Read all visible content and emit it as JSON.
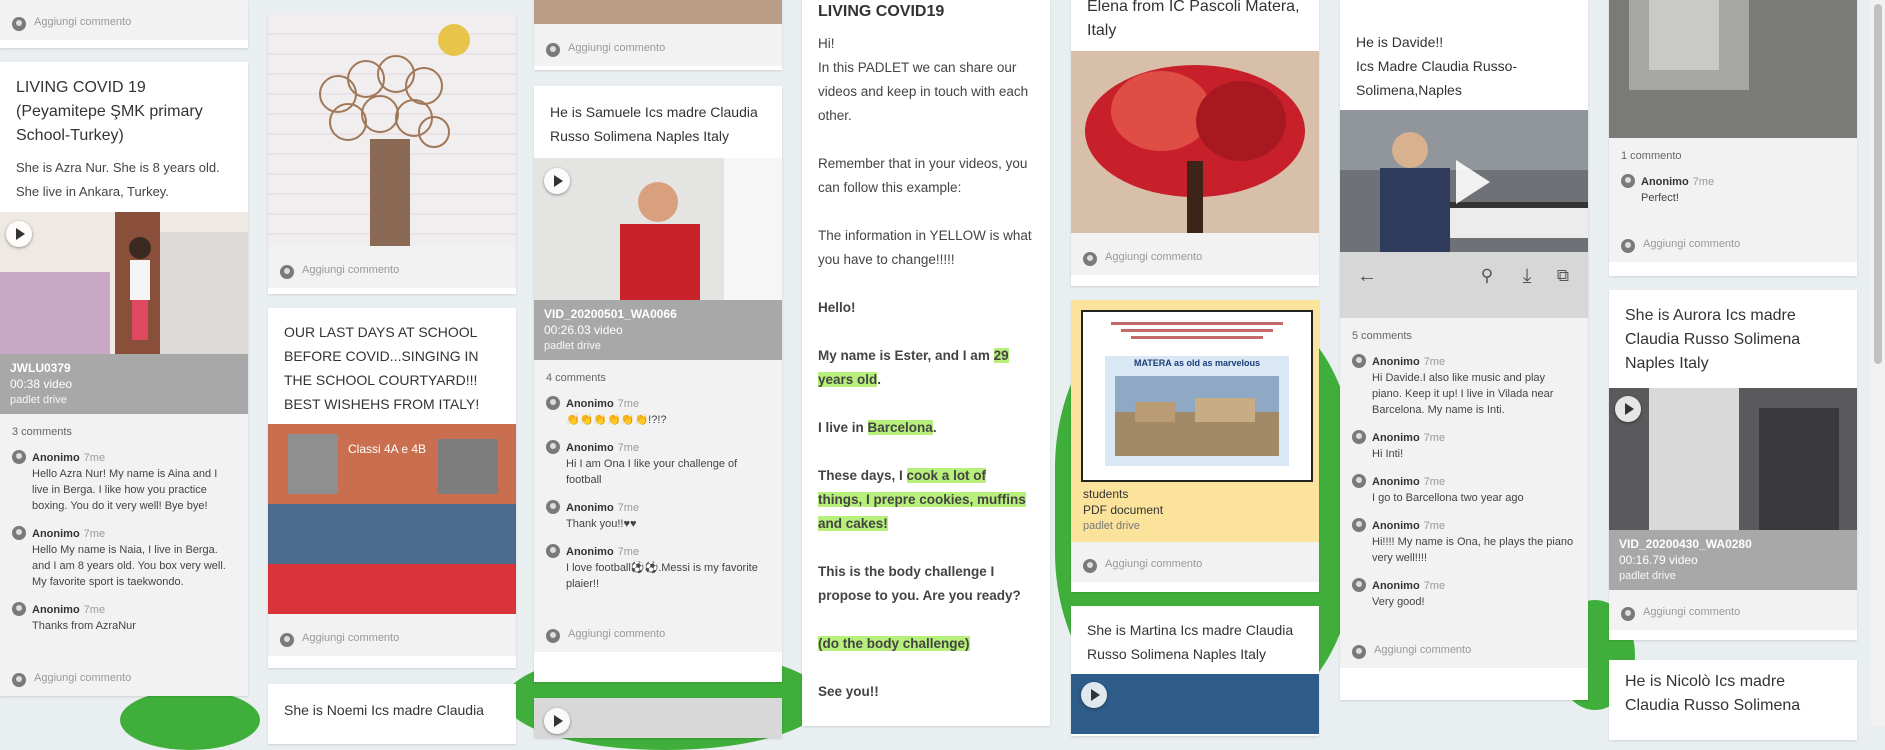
{
  "ui": {
    "add_comment": "Aggiungi commento",
    "author": "Anonimo",
    "time": "7me"
  },
  "col1": {
    "top_add": "Aggiungi commento",
    "title": "LIVING COVID 19 (Peyamitepe ŞMK primary School-Turkey)",
    "body": "She is Azra Nur. She is 8 years old. She live in Ankara, Turkey.",
    "attachment": {
      "name": "JWLU0379",
      "sub": "00:38 video",
      "src": "padlet drive"
    },
    "comment_count": "3 comments",
    "comments": [
      {
        "text": "Hello Azra Nur! My name is Aina and I live in Berga. I like how you practice boxing. You do it very well! Bye bye!"
      },
      {
        "text": "Hello My name is Naia, I live in Berga. and I am 8 years old. You box very well. My favorite sport is taekwondo."
      },
      {
        "text": "Thanks from AzraNur"
      }
    ]
  },
  "col2": {
    "title": "OUR LAST DAYS AT SCHOOL BEFORE COVID...SINGING IN THE SCHOOL COURTYARD!!! BEST WISHEHS FROM ITALY!",
    "photo_caption": "Classi 4A e 4B",
    "next_title": "She is Noemi Ics madre Claudia"
  },
  "col3": {
    "title": "He is Samuele Ics madre Claudia Russo Solimena Naples Italy",
    "attachment": {
      "name": "VID_20200501_WA0066",
      "sub": "00:26.03 video",
      "src": "padlet drive"
    },
    "comment_count": "4 comments",
    "comments": [
      {
        "text": "👏👏👏👏👏👏!?!?"
      },
      {
        "text": "Hi I am Ona I like your challenge of football"
      },
      {
        "text": "Thank you!!♥♥"
      },
      {
        "text": "I love football⚽⚽.Messi is my favorite plaier!!"
      }
    ]
  },
  "col4": {
    "title": "LIVING COVID19",
    "p1": "Hi!",
    "p2": "In this PADLET we can share our videos and keep in touch with each other.",
    "p3": "Remember that in your videos, you can follow this example:",
    "p4": "The information in YELLOW is what you have to change!!!!!",
    "p5": "Hello!",
    "p6a": "My name is Ester, and I am ",
    "p6b": "29 years old",
    "p6c": ".",
    "p7a": "I live in ",
    "p7b": "Barcelona",
    "p7c": ".",
    "p8a": "These days, I ",
    "p8b": "cook a lot of things, I prepre cookies, muffins and cakes!",
    "p9": "This is the body challenge I propose to you. Are you ready?",
    "p10": "(do the body challenge)",
    "p11": "See you!!"
  },
  "col5": {
    "title": "Elena from IC Pascoli Matera, Italy",
    "doc_heading": "MATERA as old as marvelous",
    "attachment": {
      "name": "students",
      "sub": "PDF document",
      "src": "padlet drive"
    },
    "title2": "She is Martina Ics madre Claudia Russo Solimena Naples Italy"
  },
  "col6": {
    "title": "He is Davide!!",
    "subtitle": "Ics Madre Claudia Russo-Solimena,Naples",
    "comment_count": "5 comments",
    "comments": [
      {
        "text": "Hi Davide.I also like music and play piano. Keep it up! I live in Vilada near Barcelona. My name is Inti."
      },
      {
        "text": "Hi Inti!"
      },
      {
        "text": "I go to Barcellona two year ago"
      },
      {
        "text": "Hi!!!! My name is Ona, he plays the piano very well!!!!"
      },
      {
        "text": "Very good!"
      }
    ]
  },
  "col7": {
    "comment_count": "1 commento",
    "comments": [
      {
        "text": "Perfect!"
      }
    ],
    "title": "She is Aurora Ics madre Claudia Russo Solimena Naples Italy",
    "attachment": {
      "name": "VID_20200430_WA0280",
      "sub": "00:16.79 video",
      "src": "padlet drive"
    },
    "title2": "He is Nicolò Ics madre Claudia Russo Solimena"
  },
  "colors": {
    "green_bg": "#3fae3a",
    "highlight": "#b6f07a",
    "attach_bg": "#a8a8a8"
  }
}
